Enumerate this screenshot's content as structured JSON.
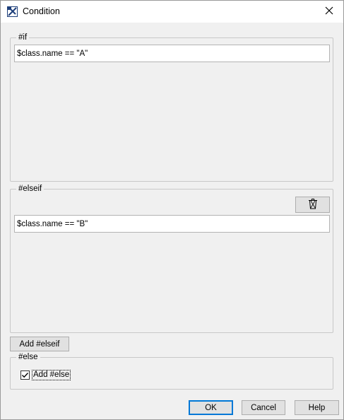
{
  "window": {
    "title": "Condition"
  },
  "icons": {
    "app": "magicdraw-app-icon",
    "close": "close-icon",
    "trash": "trash-icon",
    "check": "checkmark-icon"
  },
  "if_section": {
    "legend": "#if",
    "expression": "$class.name == \"A\""
  },
  "elseif_section": {
    "legend": "#elseif",
    "expression": "$class.name == \"B\""
  },
  "add_elseif_label": "Add #elseif",
  "else_section": {
    "legend": "#else",
    "checkbox_label": "Add #else",
    "checked": true
  },
  "footer": {
    "ok_label": "OK",
    "cancel_label": "Cancel",
    "help_label": "Help"
  },
  "colors": {
    "dialog_bg": "#f0f0f0",
    "focus_blue": "#0078d7"
  }
}
